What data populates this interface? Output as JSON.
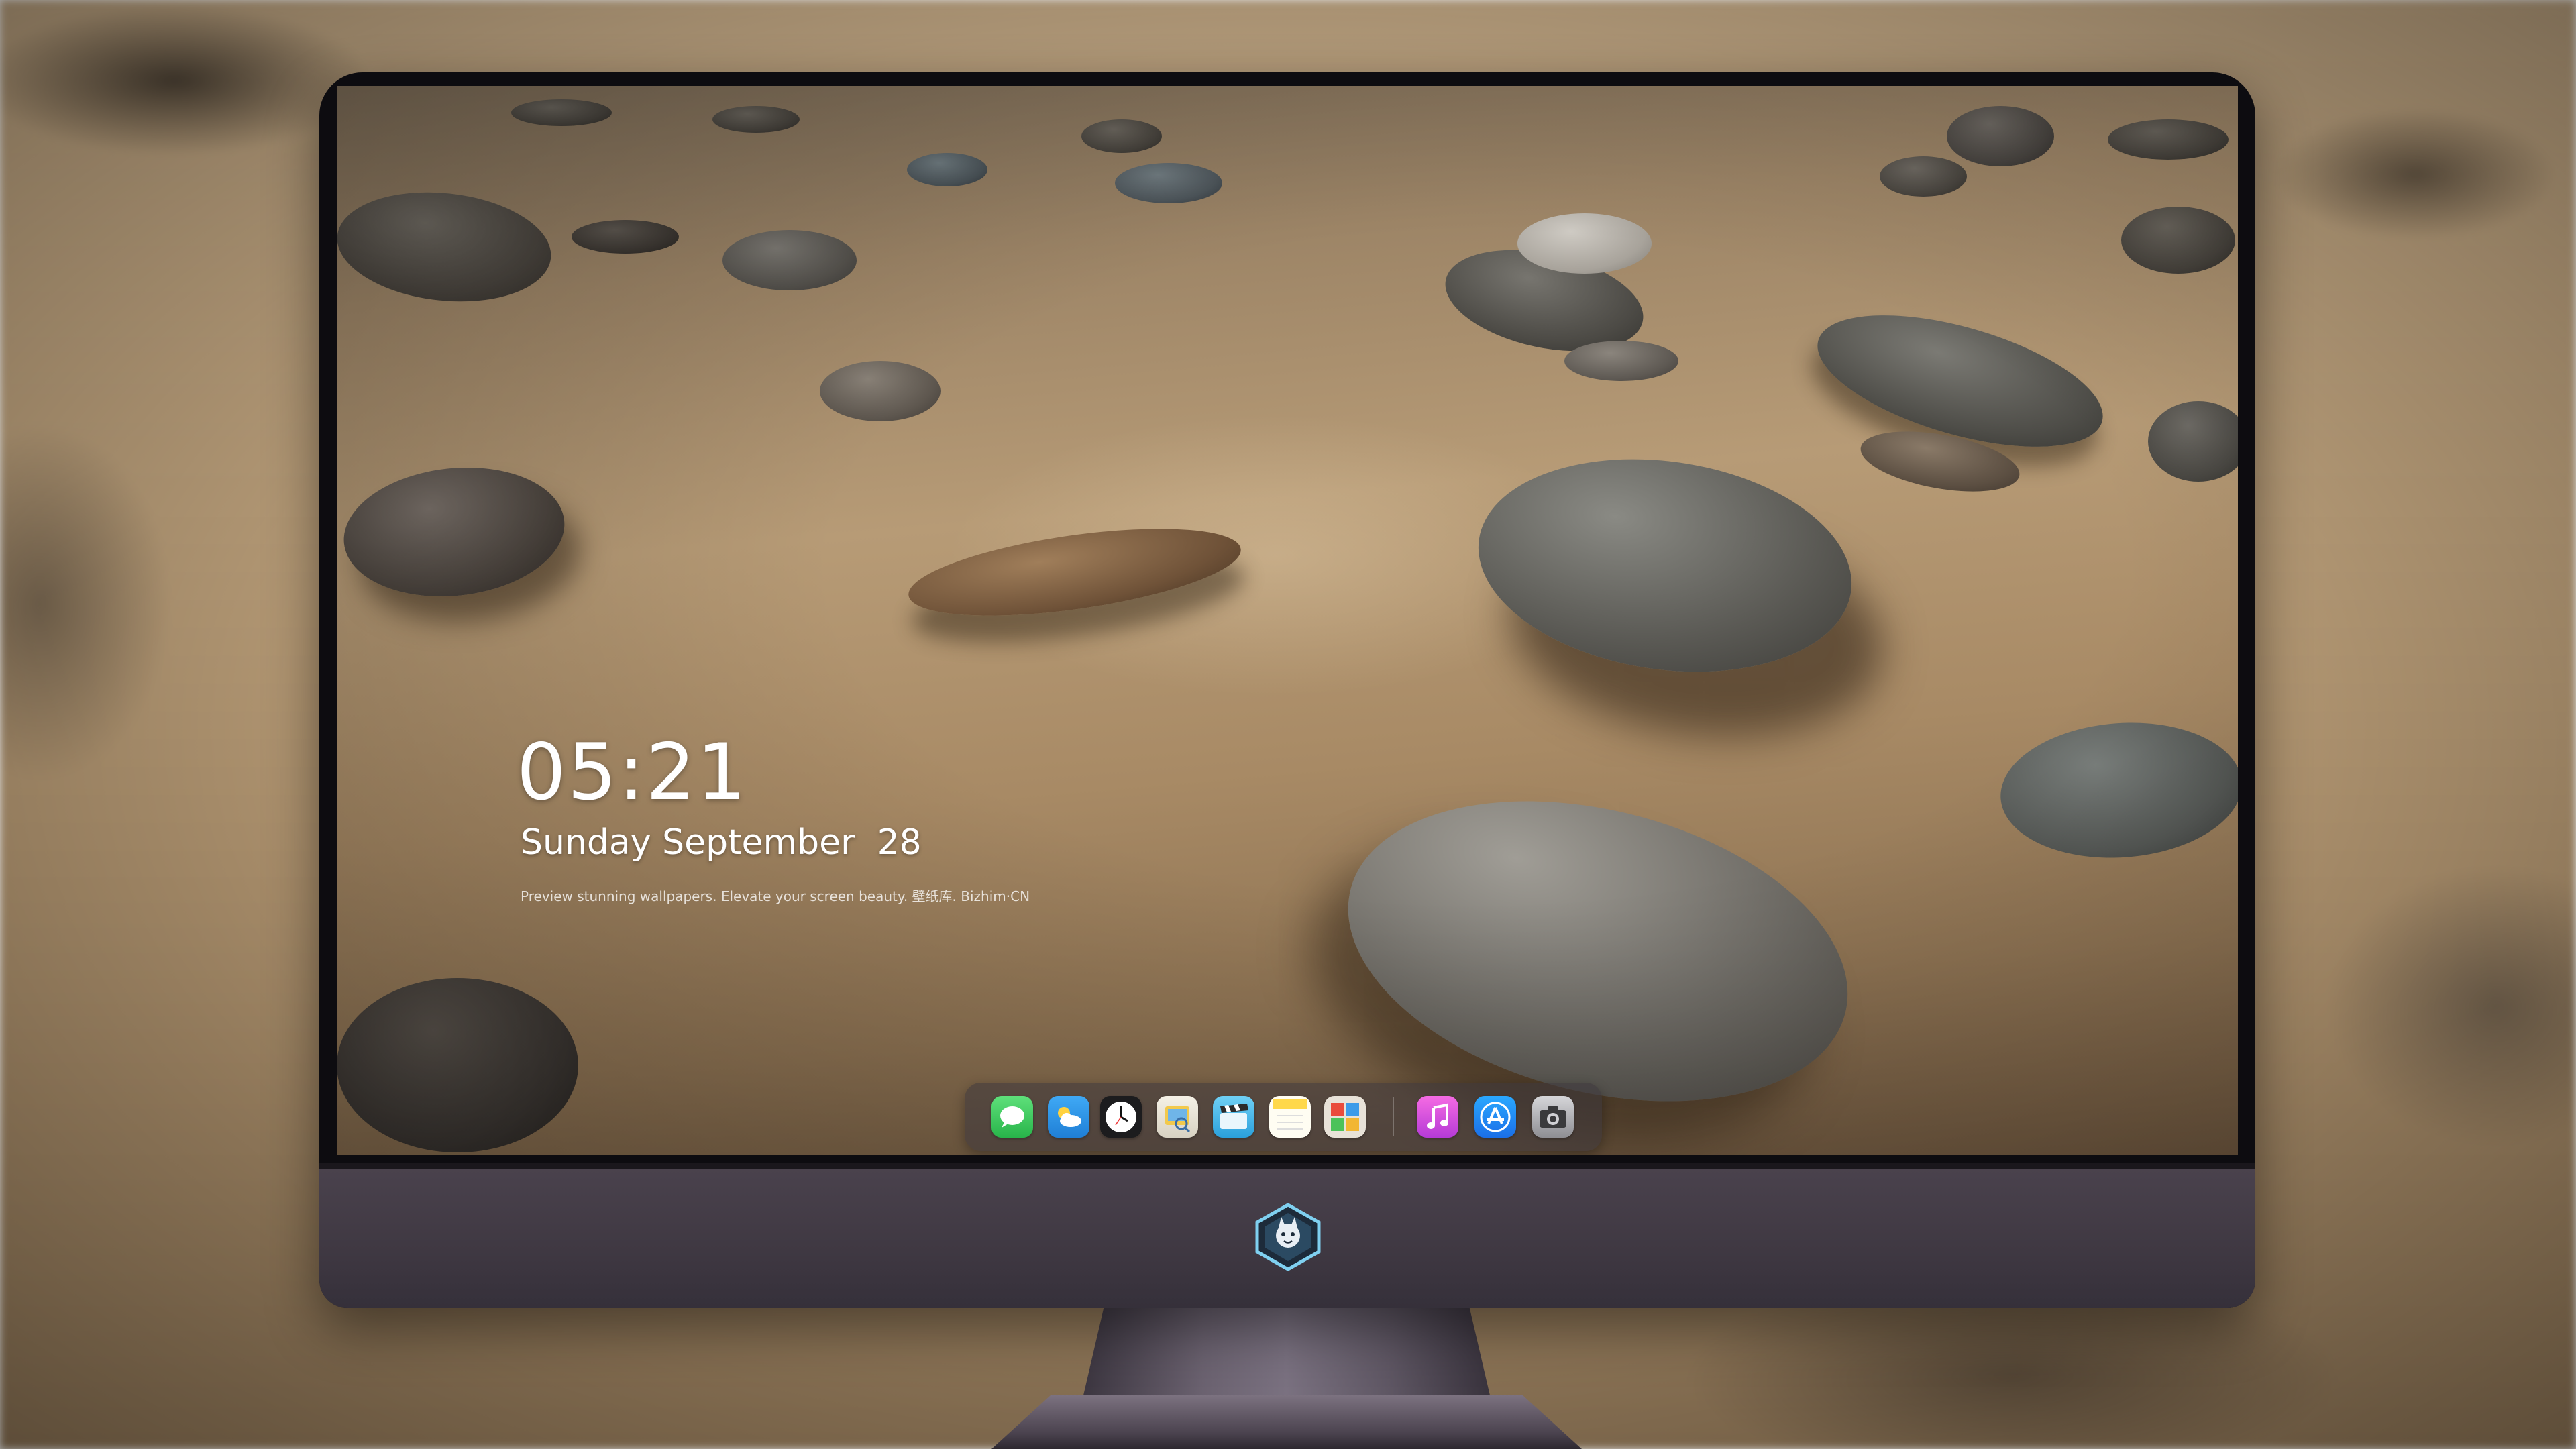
{
  "lockscreen": {
    "time": "05:21",
    "date": "Sunday September  28",
    "caption": "Preview stunning wallpapers. Elevate your screen beauty. 壁纸库. Bizhim·CN"
  },
  "dock": {
    "items": [
      {
        "name": "messages-icon",
        "color": "#34c759"
      },
      {
        "name": "weather-icon",
        "color": "#2f9bf0"
      },
      {
        "name": "clock-icon",
        "color": "#1c1c1e"
      },
      {
        "name": "preview-icon",
        "color": "#f2c94c"
      },
      {
        "name": "clips-icon",
        "color": "#4fb8e8"
      },
      {
        "name": "notes-icon",
        "color": "#ffd84a"
      },
      {
        "name": "photo-booth-icon",
        "color": "#e8e2d8"
      },
      {
        "name": "music-icon",
        "color": "#e04bd6"
      },
      {
        "name": "app-store-icon",
        "color": "#1e8ef5"
      },
      {
        "name": "camera-icon",
        "color": "#8e8e93"
      }
    ]
  },
  "colors": {
    "monitor_bezel": "#0d0c10",
    "monitor_chin": "#443c47",
    "sand": "#b79b76"
  }
}
